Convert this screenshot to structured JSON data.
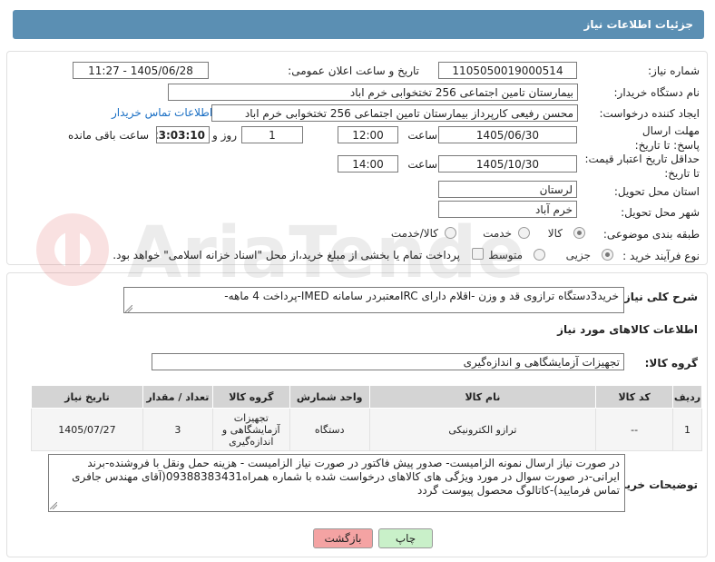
{
  "panel": {
    "title": "جزئیات اطلاعات نیاز"
  },
  "form": {
    "need_number": {
      "label": "شماره نیاز:",
      "value": "1105050019000514"
    },
    "announce_datetime": {
      "label": "تاریخ و ساعت اعلان عمومی:",
      "value": "1405/06/28 - 11:27"
    },
    "buyer_org": {
      "label": "نام دستگاه خریدار:",
      "value": "بیمارستان تامین اجتماعی  256 تختخوابی خرم اباد"
    },
    "requester": {
      "label": "ایجاد کننده درخواست:",
      "value": "محسن رفیعی کارپرداز بیمارستان تامین اجتماعی  256 تختخوابی خرم اباد",
      "contact_link": "اطلاعات تماس خریدار"
    },
    "reply_deadline": {
      "label": "مهلت ارسال پاسخ: تا تاریخ:",
      "date": "1405/06/30",
      "time_label": "ساعت",
      "time": "12:00",
      "days": "1",
      "days_label": "روز و",
      "remaining": "23:03:10",
      "remaining_label": "ساعت باقی مانده"
    },
    "price_validity": {
      "label": "حداقل تاریخ اعتبار قیمت: تا تاریخ:",
      "date": "1405/10/30",
      "time_label": "ساعت",
      "time": "14:00"
    },
    "province": {
      "label": "استان محل تحویل:",
      "value": "لرستان"
    },
    "city": {
      "label": "شهر محل تحویل:",
      "value": "خرم آباد"
    },
    "category": {
      "label": "طبقه بندی موضوعی:",
      "options": [
        "کالا",
        "خدمت",
        "کالا/خدمت"
      ],
      "selected": "کالا"
    },
    "process": {
      "label": "نوع فرآیند خرید :",
      "options": [
        "جزیی",
        "متوسط"
      ],
      "selected": "جزیی",
      "payment_note": "پرداخت تمام یا بخشی از مبلغ خرید،از محل \"اسناد خزانه اسلامی\" خواهد بود."
    }
  },
  "description": {
    "label": "شرح کلی نیاز:",
    "value": "خرید3دستگاه ترازوی قد و وزن -اقلام دارای IRCمعتبردر سامانه IMED-پرداخت 4 ماهه-"
  },
  "goods": {
    "section_title": "اطلاعات کالاهای مورد نیاز",
    "group_label": "گروه کالا:",
    "group_value": "تجهیزات آزمایشگاهی و اندازه‌گیری",
    "columns": [
      "ردیف",
      "کد کالا",
      "نام کالا",
      "واحد شمارش",
      "گروه کالا",
      "تعداد / مقدار",
      "تاریخ نیاز"
    ],
    "rows": [
      {
        "row": "1",
        "code": "--",
        "name": "ترازو الکترونیکی",
        "unit": "دستگاه",
        "group": "تجهیزات آزمایشگاهی و اندازه‌گیری",
        "qty": "3",
        "date": "1405/07/27"
      }
    ]
  },
  "buyer_notes": {
    "label": "توضیحات خریدار:",
    "value": "در صورت نیاز ارسال نمونه الزامیست- صدور پیش فاکتور در صورت نیاز الزامیست - هزینه حمل ونقل با فروشنده-برند ایرانی-در صورت سوال در مورد ویژگی های کالاهای درخواست شده با شماره همراه09388383431(آقای مهندس جافری تماس فرمایید)-کاتالوگ محصول پیوست گردد"
  },
  "buttons": {
    "print": "چاپ",
    "back": "بازگشت"
  },
  "watermark": {
    "text": "AriaTender.neT"
  },
  "colors": {
    "header": "#5b8fb3",
    "back_button": "#f4a3a3",
    "print_button": "#c9f0c9",
    "link": "#1a6fc4"
  }
}
